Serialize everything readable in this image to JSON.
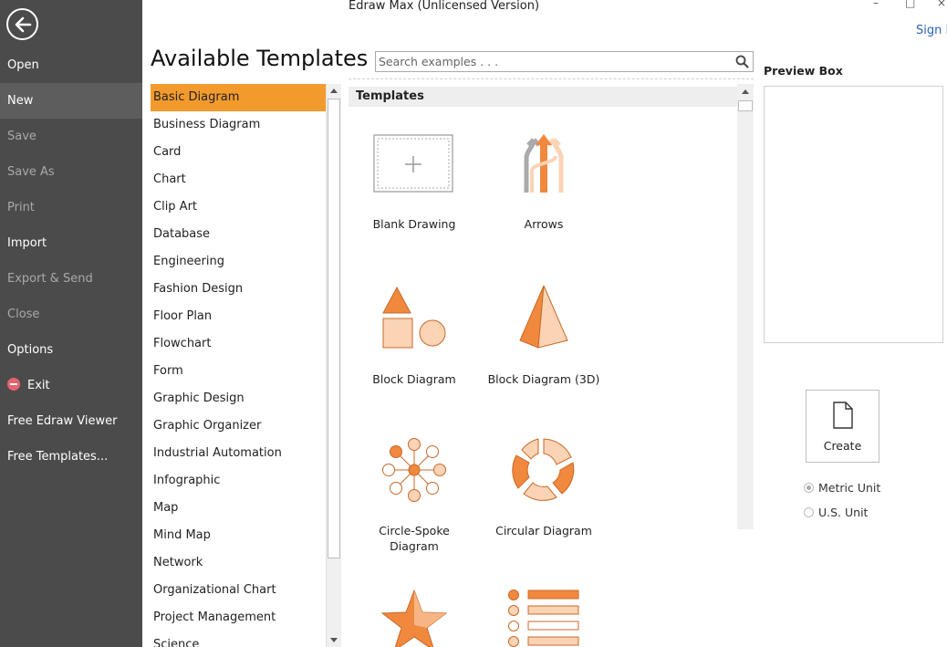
{
  "window": {
    "title": "Edraw Max (Unlicensed Version)",
    "minimize_glyph": "–",
    "maximize_glyph": "□",
    "close_glyph": "×",
    "sign_in": "Sign I"
  },
  "sidebar": {
    "back_icon": "back-arrow-icon",
    "items": [
      {
        "label": "Open",
        "state": "enabled"
      },
      {
        "label": "New",
        "state": "selected"
      },
      {
        "label": "Save",
        "state": "disabled"
      },
      {
        "label": "Save As",
        "state": "disabled"
      },
      {
        "label": "Print",
        "state": "disabled"
      },
      {
        "label": "Import",
        "state": "enabled"
      },
      {
        "label": "Export & Send",
        "state": "disabled"
      },
      {
        "label": "Close",
        "state": "disabled"
      },
      {
        "label": "Options",
        "state": "enabled"
      },
      {
        "label": "Exit",
        "state": "enabled",
        "icon": "exit-icon"
      },
      {
        "label": "Free Edraw Viewer",
        "state": "enabled"
      },
      {
        "label": "Free Templates...",
        "state": "enabled"
      }
    ]
  },
  "main": {
    "heading": "Available Templates",
    "search": {
      "placeholder": "Search examples . . .",
      "value": ""
    },
    "categories": [
      "Basic Diagram",
      "Business Diagram",
      "Card",
      "Chart",
      "Clip Art",
      "Database",
      "Engineering",
      "Fashion Design",
      "Floor Plan",
      "Flowchart",
      "Form",
      "Graphic Design",
      "Graphic Organizer",
      "Industrial Automation",
      "Infographic",
      "Map",
      "Mind Map",
      "Network",
      "Organizational Chart",
      "Project Management",
      "Science"
    ],
    "selected_category": "Basic Diagram",
    "templates_header": "Templates",
    "templates": [
      {
        "label": "Blank Drawing",
        "icon": "blank-drawing-icon"
      },
      {
        "label": "Arrows",
        "icon": "arrows-icon"
      },
      {
        "label": "Block Diagram",
        "icon": "block-diagram-icon"
      },
      {
        "label": "Block Diagram (3D)",
        "icon": "pyramid-icon"
      },
      {
        "label": "Circle-Spoke Diagram",
        "icon": "circle-spoke-icon"
      },
      {
        "label": "Circular Diagram",
        "icon": "circular-diagram-icon"
      },
      {
        "label": "",
        "icon": "star-icon"
      },
      {
        "label": "",
        "icon": "list-icon"
      }
    ]
  },
  "preview": {
    "title": "Preview Box",
    "create_label": "Create",
    "units": [
      {
        "label": "Metric Unit",
        "checked": true
      },
      {
        "label": "U.S. Unit",
        "checked": false
      }
    ]
  },
  "colors": {
    "sidebar_bg": "#4b4b4b",
    "accent_orange": "#f39a2d",
    "icon_orange": "#f0883e",
    "icon_peach": "#fbd3b5",
    "link_blue": "#2a63b8"
  }
}
